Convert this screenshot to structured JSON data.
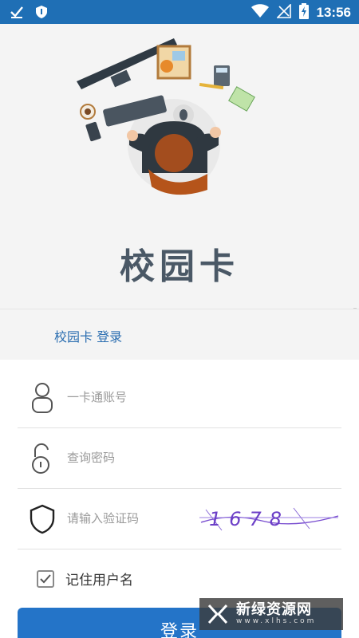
{
  "status_bar": {
    "time": "13:56",
    "icons": [
      "download-done-icon",
      "shield-icon",
      "wifi-icon",
      "signal-icon",
      "battery-charging-icon"
    ],
    "color": "#1f6fb5"
  },
  "hero": {
    "title": "校园卡",
    "illustration": "person-at-desk-illustration"
  },
  "tab": {
    "label": "校园卡 登录"
  },
  "form": {
    "account_placeholder": "一卡通账号",
    "password_placeholder": "查询密码",
    "captcha_placeholder": "请输入验证码",
    "captcha_text": "1678",
    "remember_label": "记住用户名",
    "remember_checked": true,
    "login_label": "登录"
  },
  "watermark": {
    "text": "新绿资源网",
    "sub": "www.xlhs.com"
  },
  "colors": {
    "accent": "#2474c8",
    "tab_text": "#2a6db0",
    "background": "#f4f4f4"
  }
}
